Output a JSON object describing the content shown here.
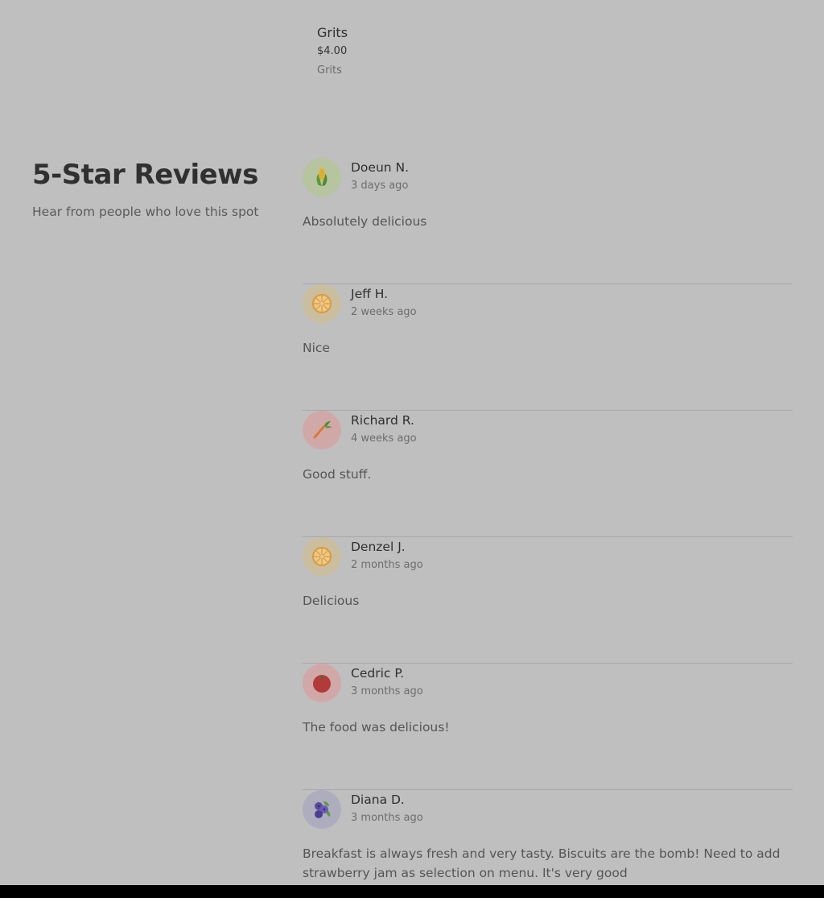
{
  "menu_item": {
    "name": "Grits",
    "price": "$4.00",
    "description": "Grits"
  },
  "reviews_section": {
    "title": "5-Star Reviews",
    "subtitle": "Hear from people who love this spot"
  },
  "reviews": [
    {
      "name": "Doeun N.",
      "time": "3 days ago",
      "text": "Absolutely delicious",
      "avatar_icon": "corn-icon"
    },
    {
      "name": "Jeff H.",
      "time": "2 weeks ago",
      "text": "Nice",
      "avatar_icon": "orange-slice-icon"
    },
    {
      "name": "Richard R.",
      "time": "4 weeks ago",
      "text": "Good stuff.",
      "avatar_icon": "carrot-icon"
    },
    {
      "name": "Denzel J.",
      "time": "2 months ago",
      "text": "Delicious",
      "avatar_icon": "orange-slice-icon"
    },
    {
      "name": "Cedric P.",
      "time": "3 months ago",
      "text": "The food was delicious!",
      "avatar_icon": "tomato-icon"
    },
    {
      "name": "Diana D.",
      "time": "3 months ago",
      "text": "Breakfast is always fresh and very tasty. Biscuits are the bomb! Need to add strawberry jam as selection on menu. It's very good",
      "avatar_icon": "blueberries-icon"
    }
  ],
  "colors": {
    "overlay_bg": "#bfbfbf",
    "divider": "#a9a9a9",
    "bottom_bar": "#000000"
  }
}
